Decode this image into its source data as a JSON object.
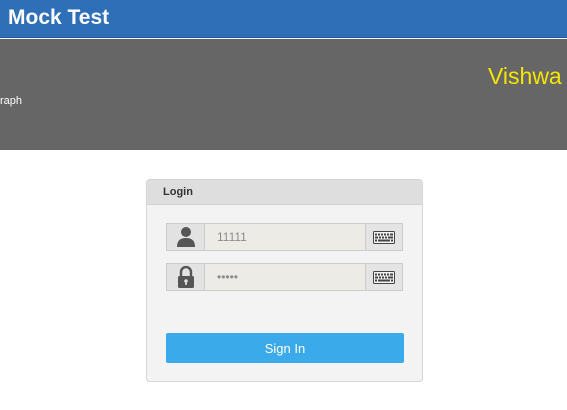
{
  "header": {
    "title": "Mock Test"
  },
  "info_bar": {
    "left_text": "raph",
    "right_text": "Vishwa"
  },
  "login": {
    "title": "Login",
    "username_value": "11111",
    "username_icon": "user-icon",
    "password_value": "•••••",
    "password_icon": "lock-icon",
    "keyboard_icon": "keyboard-icon",
    "signin_label": "Sign In"
  },
  "colors": {
    "header_bg": "#2f6fb8",
    "info_bg": "#666666",
    "accent_yellow": "#f5e600",
    "signin_bg": "#3aaaea"
  }
}
